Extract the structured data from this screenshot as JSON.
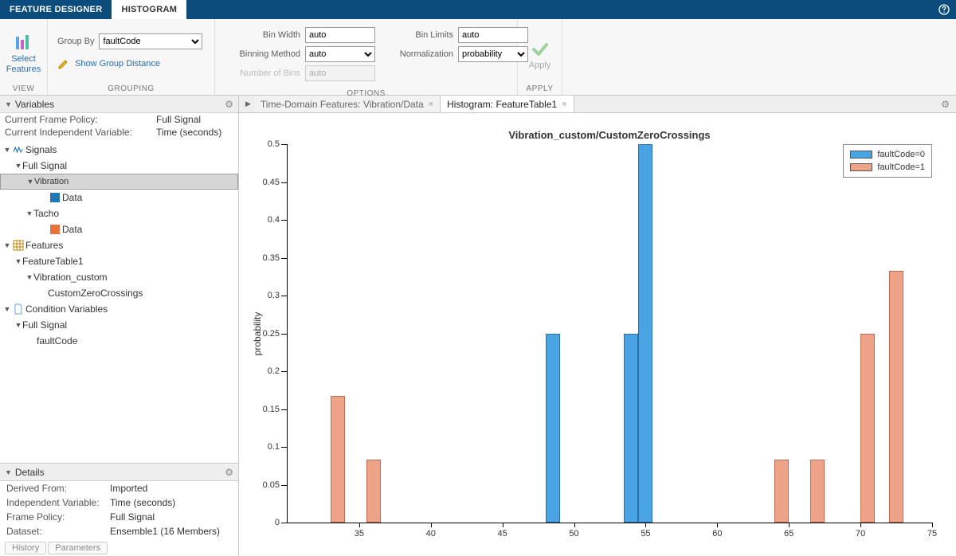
{
  "titlebar": {
    "tabs": [
      "FEATURE DESIGNER",
      "HISTOGRAM"
    ],
    "active": 1
  },
  "ribbon": {
    "view": {
      "select_features": "Select\nFeatures",
      "label": "VIEW"
    },
    "grouping": {
      "group_by_label": "Group By",
      "group_by_value": "faultCode",
      "show_distance": "Show Group Distance",
      "label": "GROUPING"
    },
    "options": {
      "bin_width_label": "Bin Width",
      "bin_width_value": "auto",
      "binning_method_label": "Binning Method",
      "binning_method_value": "auto",
      "num_bins_label": "Number of Bins",
      "num_bins_value": "auto",
      "bin_limits_label": "Bin Limits",
      "bin_limits_value": "auto",
      "normalization_label": "Normalization",
      "normalization_value": "probability",
      "label": "OPTIONS"
    },
    "apply": {
      "btn": "Apply",
      "label": "APPLY"
    }
  },
  "variables": {
    "header": "Variables",
    "frame_policy_k": "Current Frame Policy:",
    "frame_policy_v": "Full Signal",
    "indep_var_k": "Current Independent Variable:",
    "indep_var_v": "Time (seconds)",
    "nodes": {
      "signals": "Signals",
      "full_signal1": "Full Signal",
      "vibration": "Vibration",
      "data1": "Data",
      "tacho": "Tacho",
      "data2": "Data",
      "features": "Features",
      "ftable": "FeatureTable1",
      "vib_custom": "Vibration_custom",
      "czc": "CustomZeroCrossings",
      "cond_vars": "Condition Variables",
      "full_signal2": "Full Signal",
      "faultcode": "faultCode"
    }
  },
  "details": {
    "header": "Details",
    "rows": [
      {
        "k": "Derived From:",
        "v": "Imported"
      },
      {
        "k": "Independent Variable:",
        "v": "Time (seconds)"
      },
      {
        "k": "Frame Policy:",
        "v": "Full Signal"
      },
      {
        "k": "Dataset:",
        "v": "Ensemble1 (16 Members)"
      }
    ],
    "tabs": [
      "History",
      "Parameters"
    ]
  },
  "doctabs": {
    "tabs": [
      "Time-Domain Features: Vibration/Data",
      "Histogram: FeatureTable1"
    ],
    "active": 1
  },
  "chart_data": {
    "type": "bar",
    "title": "Vibration_custom/CustomZeroCrossings",
    "ylabel": "probability",
    "xlim": [
      30,
      75
    ],
    "ylim": [
      0,
      0.5
    ],
    "yticks": [
      0,
      0.05,
      0.1,
      0.15,
      0.2,
      0.25,
      0.3,
      0.35,
      0.4,
      0.45,
      0.5
    ],
    "xticks": [
      35,
      40,
      45,
      50,
      55,
      60,
      65,
      70,
      75
    ],
    "legend": [
      "faultCode=0",
      "faultCode=1"
    ],
    "bin_width": 1,
    "series": [
      {
        "name": "faultCode=0",
        "cls": "b0",
        "bars": [
          {
            "x": 48.5,
            "y": 0.25
          },
          {
            "x": 54,
            "y": 0.25
          },
          {
            "x": 55,
            "y": 0.5
          }
        ]
      },
      {
        "name": "faultCode=1",
        "cls": "b1",
        "bars": [
          {
            "x": 33.5,
            "y": 0.167
          },
          {
            "x": 36,
            "y": 0.083
          },
          {
            "x": 64.5,
            "y": 0.083
          },
          {
            "x": 67,
            "y": 0.083
          },
          {
            "x": 70.5,
            "y": 0.25
          },
          {
            "x": 72.5,
            "y": 0.333
          }
        ]
      }
    ],
    "colors": {
      "b0": "#4aa3e2",
      "b1": "#eea287"
    }
  }
}
